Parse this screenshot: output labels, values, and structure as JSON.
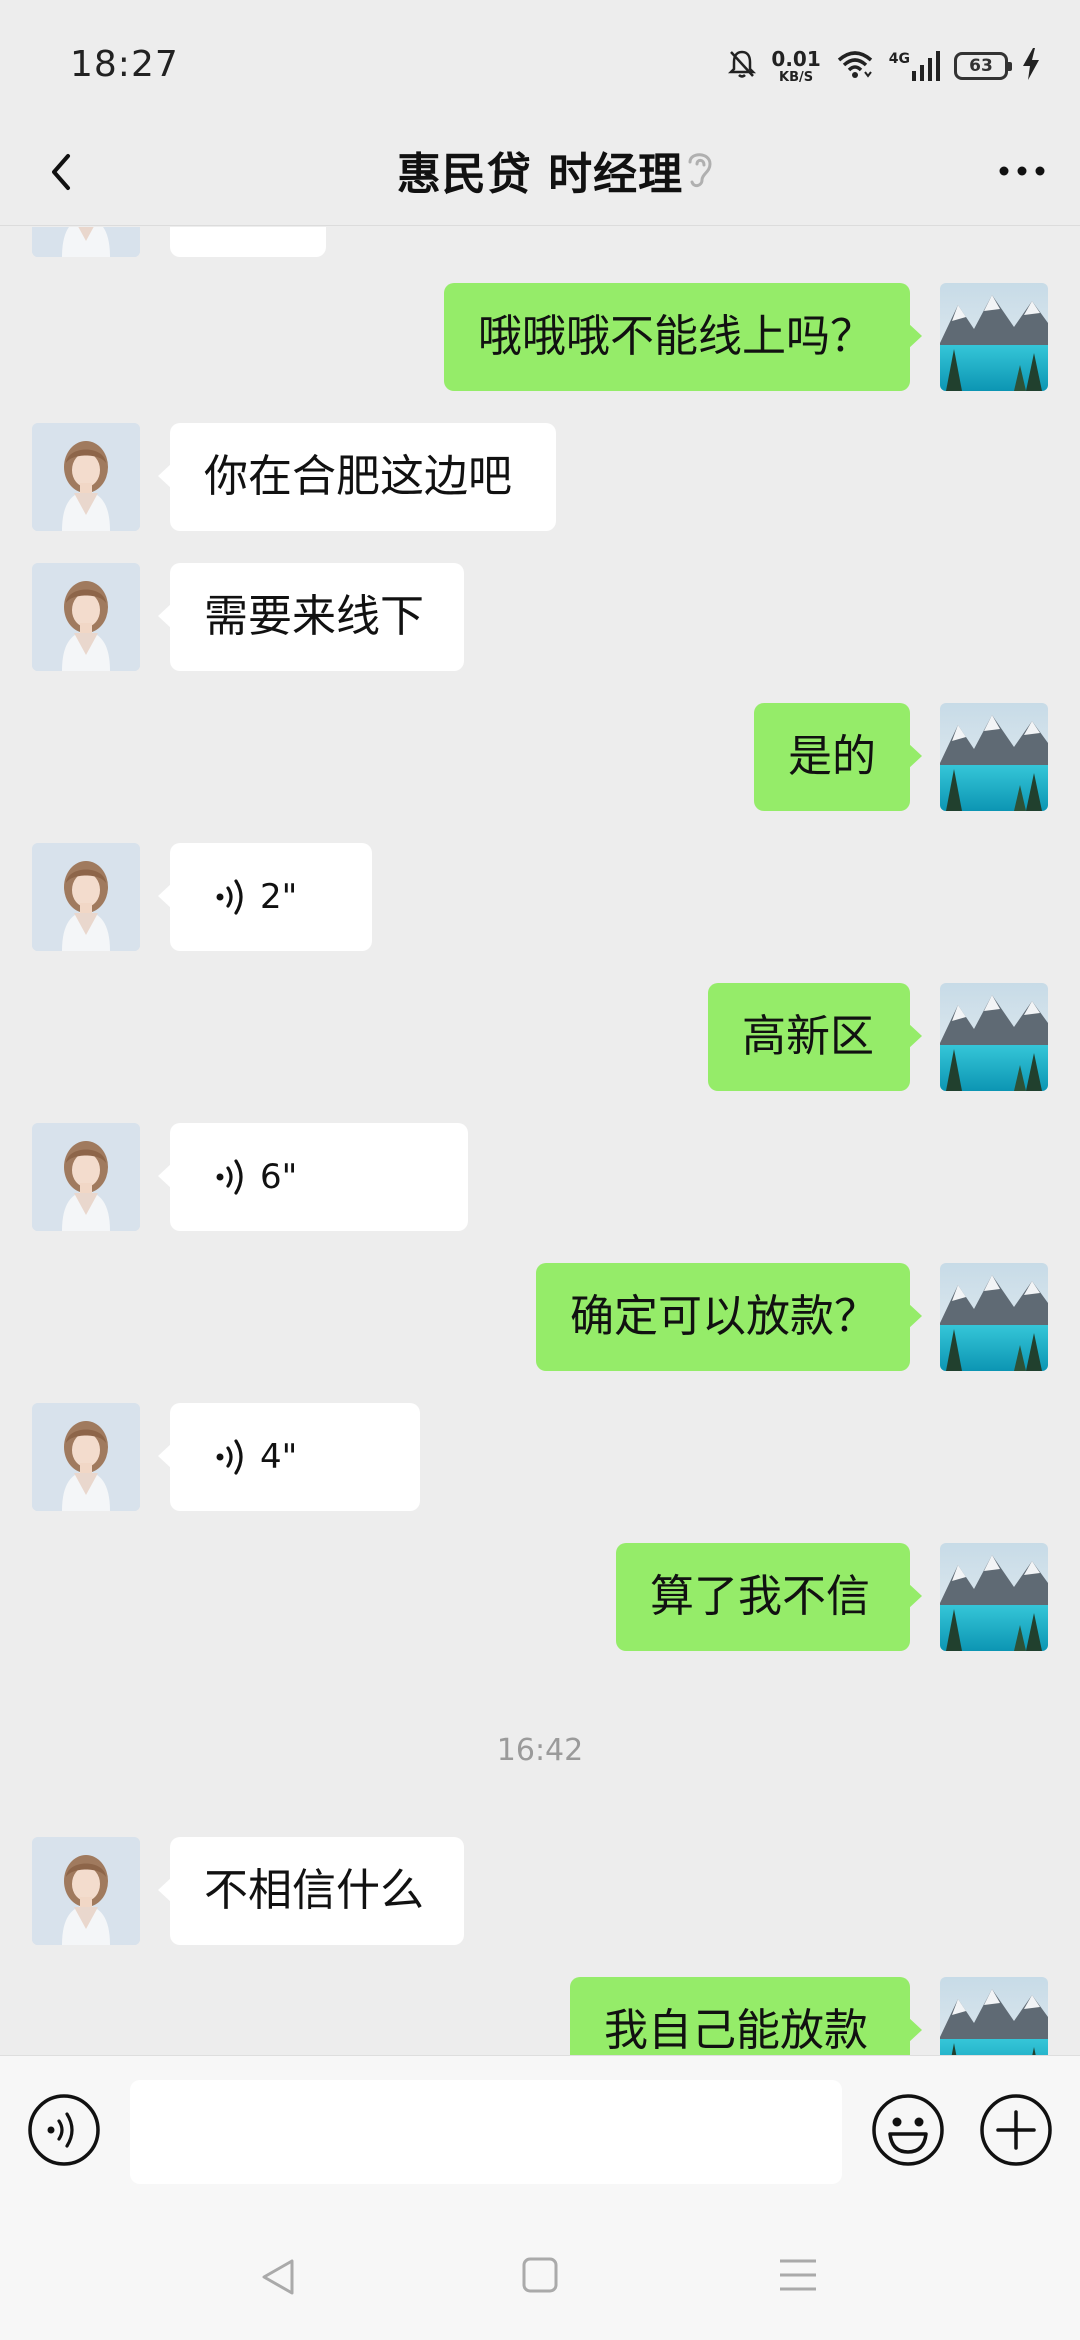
{
  "status_bar": {
    "time": "18:27",
    "net_speed_value": "0.01",
    "net_speed_unit": "KB/S",
    "network": "4G",
    "battery": "63"
  },
  "header": {
    "title": "惠民贷  时经理",
    "icons": [
      "back-icon",
      "ear-icon",
      "more-icon"
    ]
  },
  "messages": [
    {
      "side": "right",
      "type": "text",
      "text": "哦哦哦不能线上吗？"
    },
    {
      "side": "left",
      "type": "text",
      "text": "你在合肥这边吧"
    },
    {
      "side": "left",
      "type": "text",
      "text": "需要来线下"
    },
    {
      "side": "right",
      "type": "text",
      "text": "是的"
    },
    {
      "side": "left",
      "type": "voice",
      "duration": "2\""
    },
    {
      "side": "right",
      "type": "text",
      "text": "高新区"
    },
    {
      "side": "left",
      "type": "voice",
      "duration": "6\""
    },
    {
      "side": "right",
      "type": "text",
      "text": "确定可以放款？"
    },
    {
      "side": "left",
      "type": "voice",
      "duration": "4\""
    },
    {
      "side": "right",
      "type": "text",
      "text": "算了我不信"
    },
    {
      "side": "center",
      "type": "timestamp",
      "text": "16:42"
    },
    {
      "side": "left",
      "type": "text",
      "text": "不相信什么"
    },
    {
      "side": "right",
      "type": "text",
      "text": "我自己能放款"
    }
  ],
  "input_bar": {
    "value": "",
    "icons": [
      "voice-input-icon",
      "emoji-icon",
      "plus-icon"
    ]
  },
  "nav_bar": {
    "icons": [
      "nav-back-icon",
      "nav-home-icon",
      "nav-menu-icon"
    ]
  },
  "colors": {
    "background": "#ededed",
    "self_bubble": "#95ec69",
    "peer_bubble": "#ffffff",
    "timestamp": "#9a9a9a"
  }
}
